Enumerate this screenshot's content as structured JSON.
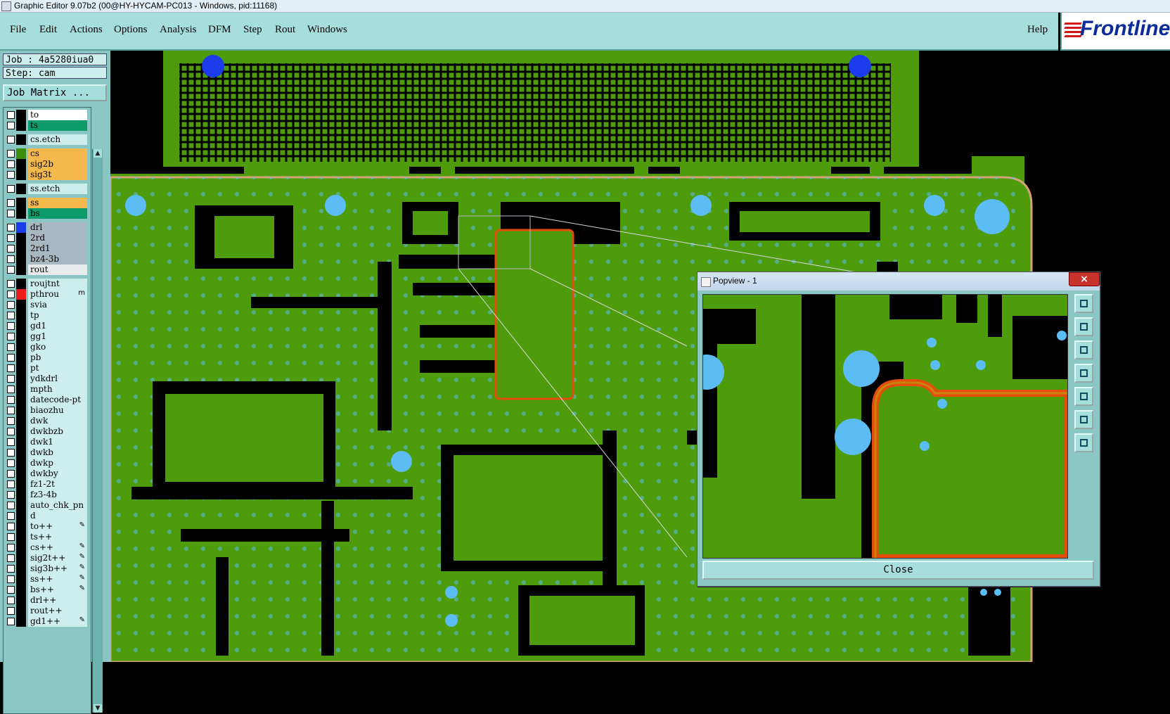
{
  "window": {
    "title": "Graphic Editor 9.07b2 (00@HY-HYCAM-PC013 - Windows, pid:11168)"
  },
  "menu": {
    "items": [
      "File",
      "Edit",
      "Actions",
      "Options",
      "Analysis",
      "DFM",
      "Step",
      "Rout",
      "Windows"
    ],
    "help": "Help"
  },
  "brand": {
    "logo_text": "Frontline"
  },
  "job": {
    "job_line": "Job : 4a5280iua0",
    "step_line": "Step: cam",
    "matrix_button": "Job Matrix ..."
  },
  "layers": [
    {
      "name": "to",
      "color": "#ffffff",
      "group": 0
    },
    {
      "name": "ts",
      "color": "#0c9c6c",
      "group": 0
    },
    {
      "name": "cs.etch",
      "color": "#cdeeed",
      "group": 1
    },
    {
      "name": "cs",
      "color": "#f4b84c",
      "group": 2,
      "swatch": "#3c8c0c"
    },
    {
      "name": "sig2b",
      "color": "#f4b84c",
      "group": 2
    },
    {
      "name": "sig3t",
      "color": "#f4b84c",
      "group": 2
    },
    {
      "name": "ss.etch",
      "color": "#cdeeed",
      "group": 3
    },
    {
      "name": "ss",
      "color": "#f4b84c",
      "group": 4
    },
    {
      "name": "bs",
      "color": "#0c9c6c",
      "group": 4
    },
    {
      "name": "drl",
      "color": "#a8b8c0",
      "group": 5,
      "swatch": "#1c3cec"
    },
    {
      "name": "2rd",
      "color": "#a8b8c0",
      "group": 5
    },
    {
      "name": "2rd1",
      "color": "#a8b8c0",
      "group": 5
    },
    {
      "name": "bz4-3b",
      "color": "#a8b8c0",
      "group": 5
    },
    {
      "name": "rout",
      "color": "#e8ecec",
      "group": 5
    },
    {
      "name": "roujtnt",
      "color": "#cdeeed",
      "group": 6
    },
    {
      "name": "pthrou",
      "color": "#cdeeed",
      "group": 6,
      "swatch": "#ec1c1c",
      "flag": "m"
    },
    {
      "name": "svia",
      "color": "#cdeeed",
      "group": 6
    },
    {
      "name": "tp",
      "color": "#cdeeed",
      "group": 6
    },
    {
      "name": "gd1",
      "color": "#cdeeed",
      "group": 6
    },
    {
      "name": "gg1",
      "color": "#cdeeed",
      "group": 6
    },
    {
      "name": "gko",
      "color": "#cdeeed",
      "group": 6
    },
    {
      "name": "pb",
      "color": "#cdeeed",
      "group": 6
    },
    {
      "name": "pt",
      "color": "#cdeeed",
      "group": 6
    },
    {
      "name": "ydkdrl",
      "color": "#cdeeed",
      "group": 6
    },
    {
      "name": "mpth",
      "color": "#cdeeed",
      "group": 6
    },
    {
      "name": "datecode-pt",
      "color": "#cdeeed",
      "group": 6
    },
    {
      "name": "biaozhu",
      "color": "#cdeeed",
      "group": 6
    },
    {
      "name": "dwk",
      "color": "#cdeeed",
      "group": 6
    },
    {
      "name": "dwkbzb",
      "color": "#cdeeed",
      "group": 6
    },
    {
      "name": "dwk1",
      "color": "#cdeeed",
      "group": 6
    },
    {
      "name": "dwkb",
      "color": "#cdeeed",
      "group": 6
    },
    {
      "name": "dwkp",
      "color": "#cdeeed",
      "group": 6
    },
    {
      "name": "dwkby",
      "color": "#cdeeed",
      "group": 6
    },
    {
      "name": "fz1-2t",
      "color": "#cdeeed",
      "group": 6
    },
    {
      "name": "fz3-4b",
      "color": "#cdeeed",
      "group": 6
    },
    {
      "name": "auto_chk_pn",
      "color": "#cdeeed",
      "group": 6
    },
    {
      "name": "d",
      "color": "#cdeeed",
      "group": 6
    },
    {
      "name": "to++",
      "color": "#cdeeed",
      "group": 6,
      "flag": "✎"
    },
    {
      "name": "ts++",
      "color": "#cdeeed",
      "group": 6
    },
    {
      "name": "cs++",
      "color": "#cdeeed",
      "group": 6,
      "flag": "✎"
    },
    {
      "name": "sig2t++",
      "color": "#cdeeed",
      "group": 6,
      "flag": "✎"
    },
    {
      "name": "sig3b++",
      "color": "#cdeeed",
      "group": 6,
      "flag": "✎"
    },
    {
      "name": "ss++",
      "color": "#cdeeed",
      "group": 6,
      "flag": "✎"
    },
    {
      "name": "bs++",
      "color": "#cdeeed",
      "group": 6,
      "flag": "✎"
    },
    {
      "name": "drl++",
      "color": "#cdeeed",
      "group": 6
    },
    {
      "name": "rout++",
      "color": "#cdeeed",
      "group": 6
    },
    {
      "name": "gd1++",
      "color": "#cdeeed",
      "group": 6,
      "flag": "✎"
    }
  ],
  "popview": {
    "title": "Popview - 1",
    "close_label": "Close",
    "close_x": "×",
    "tools": [
      "zoom-window-icon",
      "pan-up-icon",
      "pan-down-icon",
      "pan-left-icon",
      "pan-right-icon",
      "zoom-fit-icon",
      "zoom-home-icon"
    ]
  },
  "colors": {
    "copper": "#4e9c0c",
    "background": "#000000",
    "pad": "#5cbcf4",
    "board_outline": "#d4a478",
    "rout_edge": "#e84c0c",
    "panel": "#a6dedc"
  }
}
